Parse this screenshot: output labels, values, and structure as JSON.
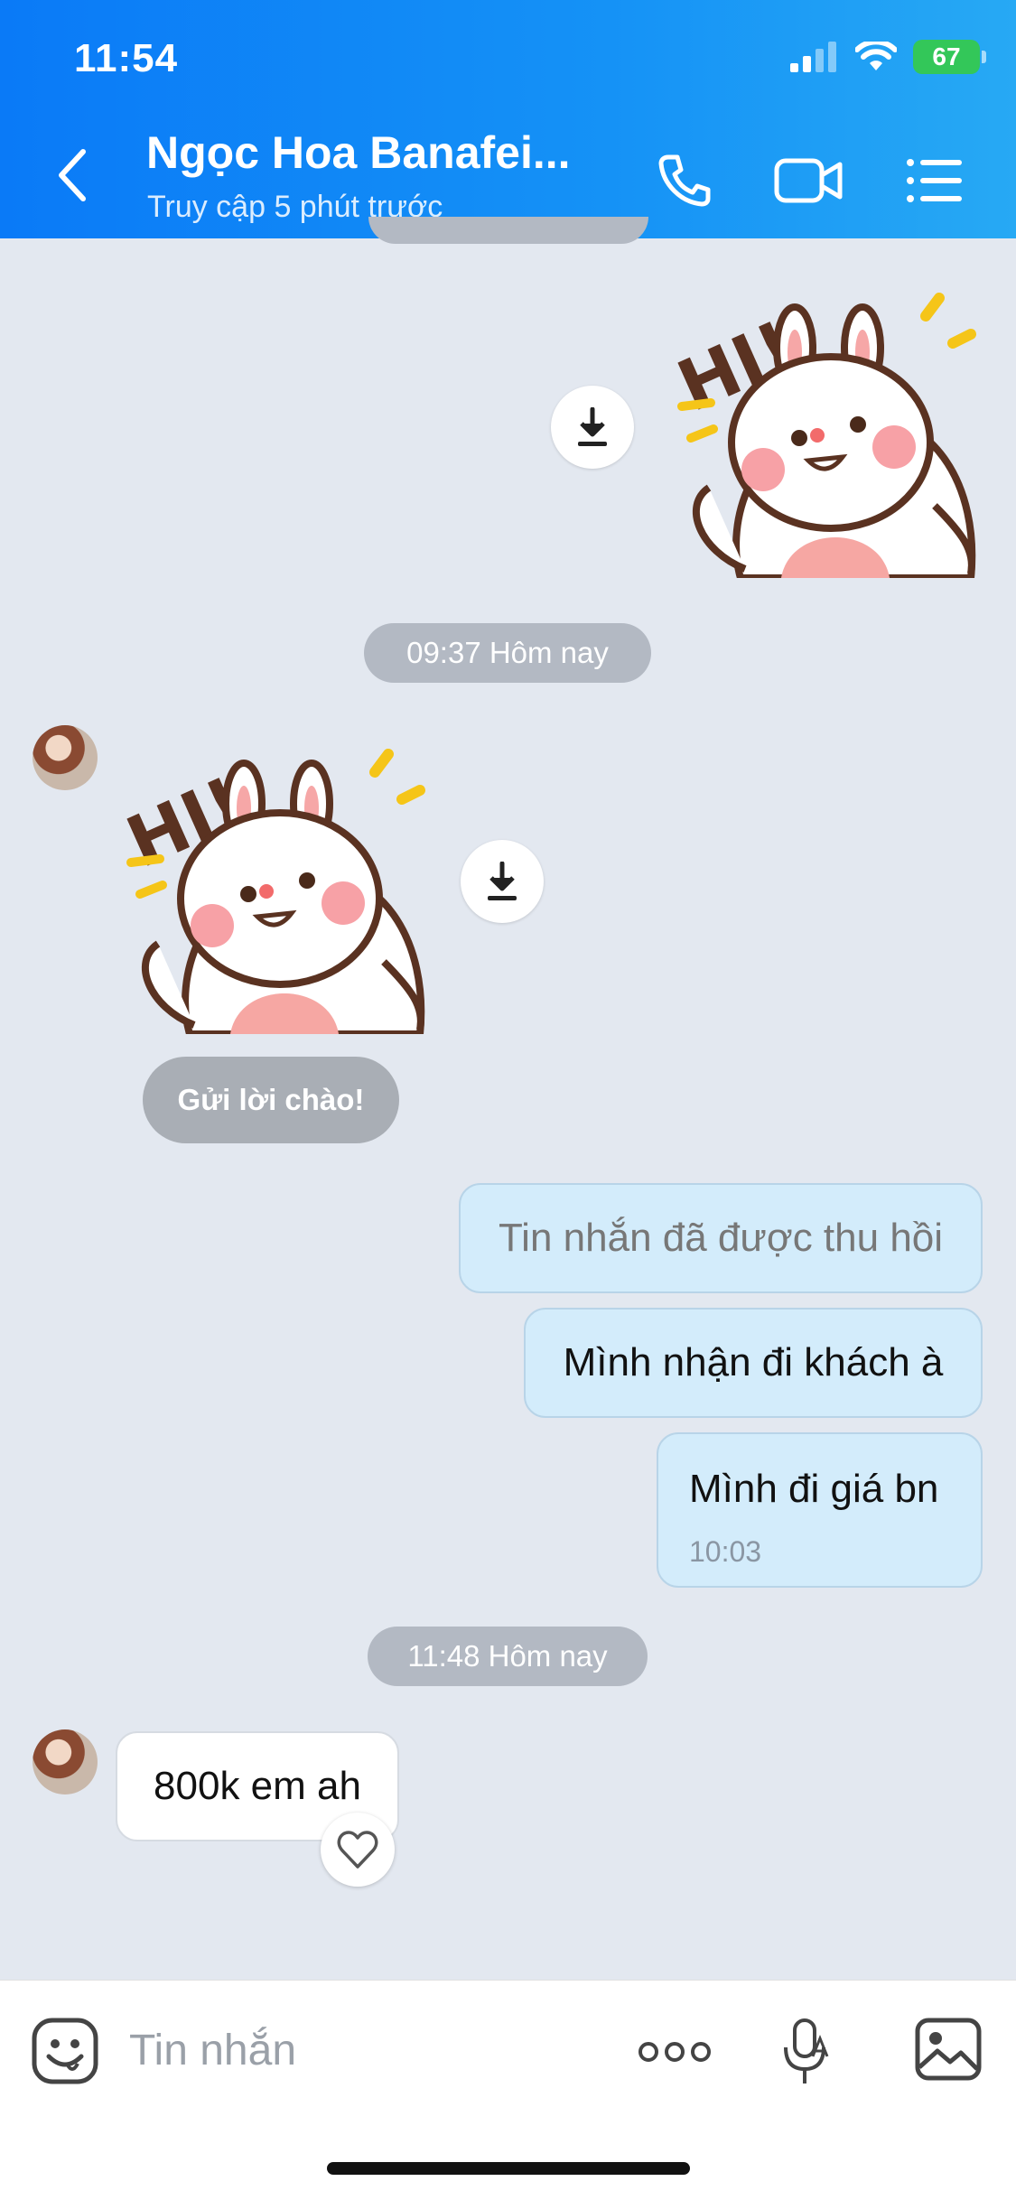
{
  "status_bar": {
    "time": "11:54",
    "battery": "67"
  },
  "header": {
    "contact_name": "Ngọc Hoa Banafei...",
    "presence": "Truy cập 5 phút trước"
  },
  "messages": {
    "time_divider_1": "09:37 Hôm nay",
    "greet_button": "Gửi lời chào!",
    "recalled": "Tin nhắn đã được thu hồi",
    "out_1": "Mình nhận đi khách à",
    "out_2": "Mình đi giá bn",
    "out_2_time": "10:03",
    "time_divider_2": "11:48 Hôm nay",
    "in_1": "800k em ah"
  },
  "sticker_text": "HI!",
  "composer": {
    "placeholder": "Tin nhắn"
  },
  "colors": {
    "header_blue": "#0a7af7",
    "bubble_out": "#d3ecfb",
    "chat_bg": "#e3e8f0"
  }
}
